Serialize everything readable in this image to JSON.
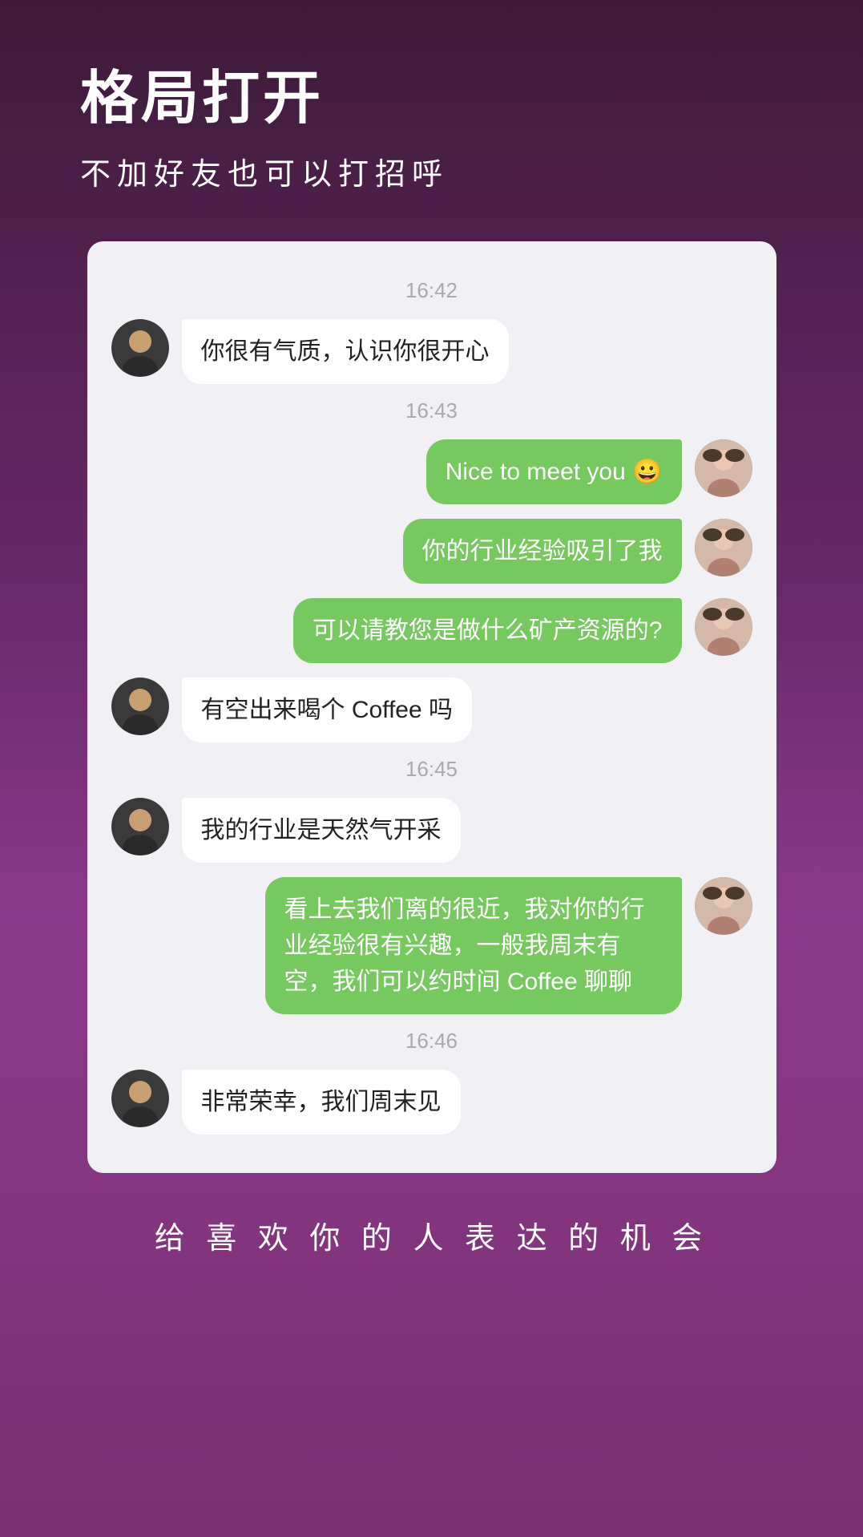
{
  "header": {
    "headline": "格局打开",
    "subheadline": "不加好友也可以打招呼"
  },
  "chat": {
    "messages": [
      {
        "id": "ts1",
        "type": "timestamp",
        "text": "16:42"
      },
      {
        "id": "msg1",
        "type": "left",
        "text": "你很有气质，认识你很开心"
      },
      {
        "id": "ts2",
        "type": "timestamp",
        "text": "16:43"
      },
      {
        "id": "msg2",
        "type": "right",
        "text": "Nice to meet you 😀"
      },
      {
        "id": "msg3",
        "type": "right",
        "text": "你的行业经验吸引了我"
      },
      {
        "id": "msg4",
        "type": "right",
        "text": "可以请教您是做什么矿产资源的?"
      },
      {
        "id": "msg5",
        "type": "left",
        "text": "有空出来喝个 Coffee 吗"
      },
      {
        "id": "ts3",
        "type": "timestamp",
        "text": "16:45"
      },
      {
        "id": "msg6",
        "type": "left",
        "text": "我的行业是天然气开采"
      },
      {
        "id": "msg7",
        "type": "right",
        "text": "看上去我们离的很近，我对你的行业经验很有兴趣，一般我周末有空，我们可以约时间 Coffee 聊聊"
      },
      {
        "id": "ts4",
        "type": "timestamp",
        "text": "16:46"
      },
      {
        "id": "msg8",
        "type": "left",
        "text": "非常荣幸，我们周末见"
      }
    ]
  },
  "footer": {
    "text": "给 喜 欢 你 的 人 表 达 的 机 会"
  }
}
